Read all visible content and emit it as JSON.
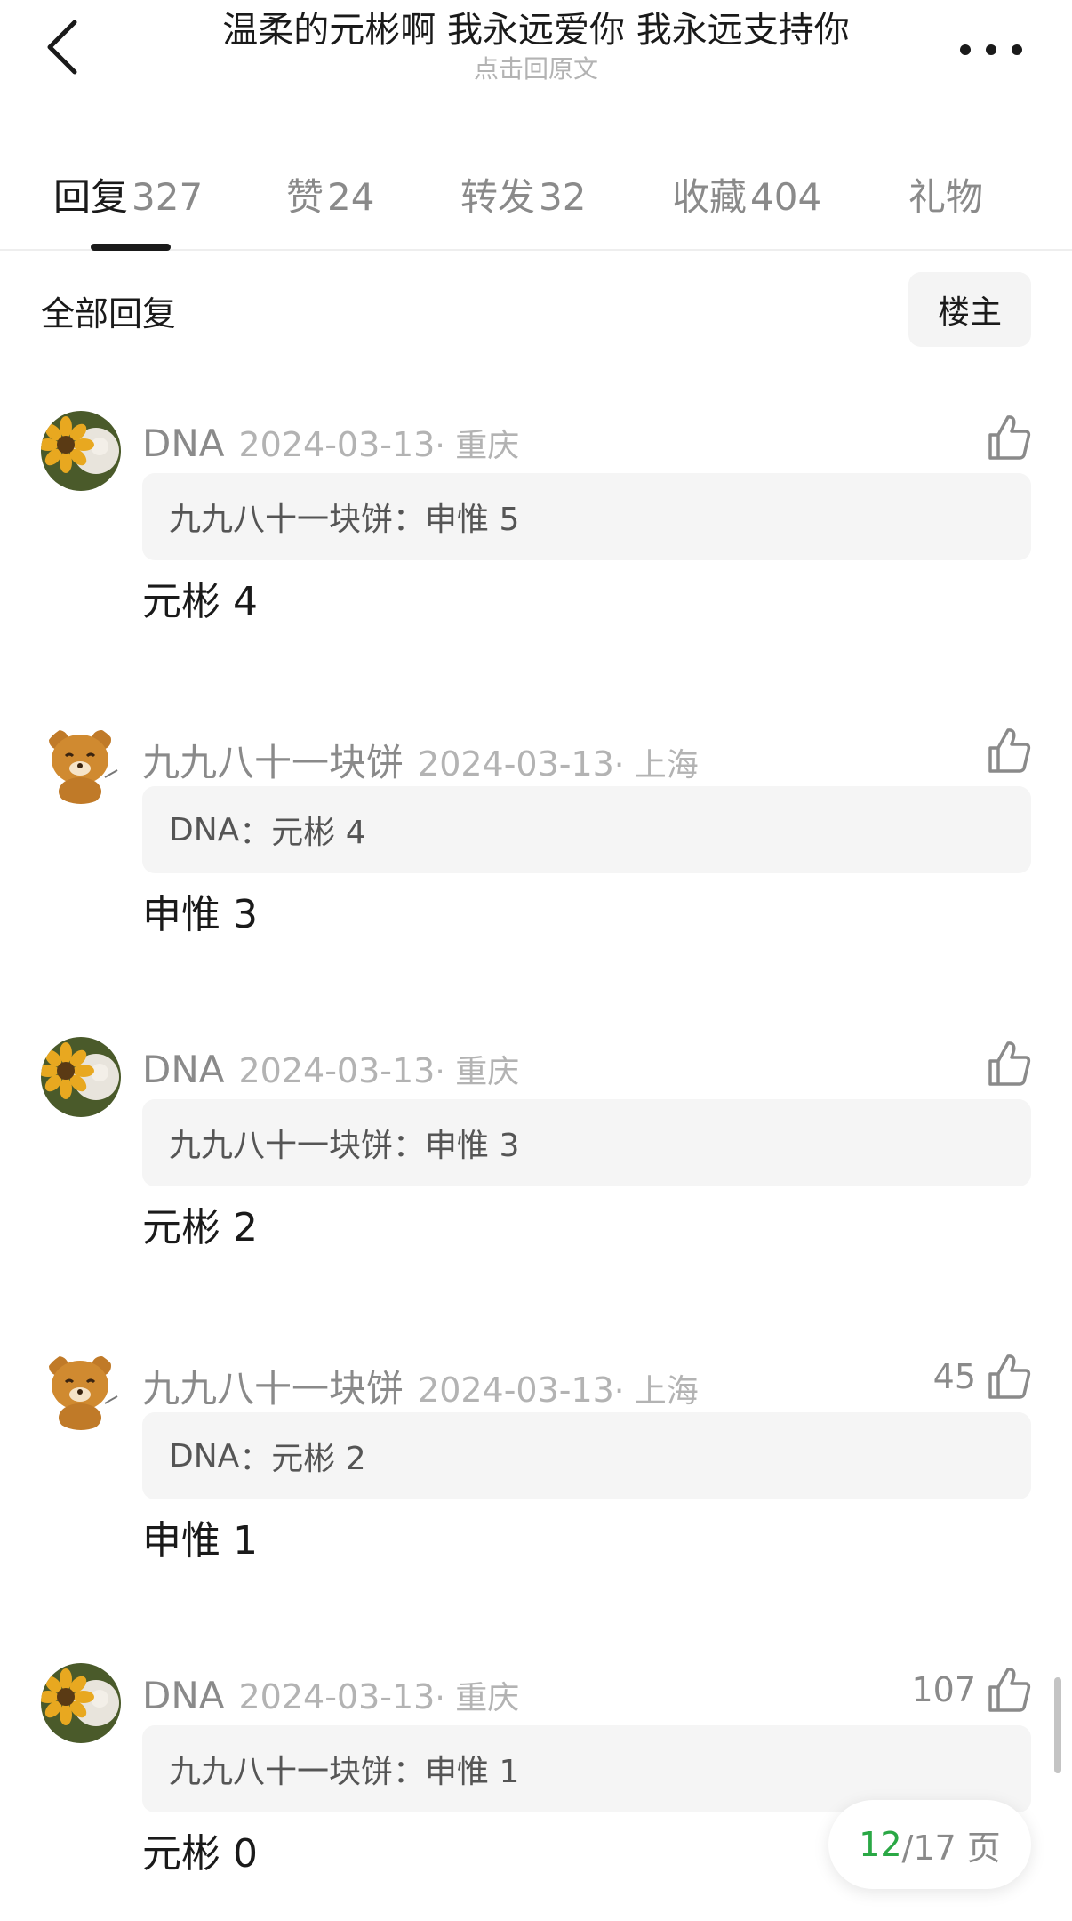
{
  "header": {
    "title": "温柔的元彬啊 我永远爱你 我永远支持你",
    "subtitle": "点击回原文",
    "back_icon": "chevron-left-icon",
    "more_icon": "more-dots-icon"
  },
  "tabs": [
    {
      "label": "回复",
      "count": "327",
      "active": true
    },
    {
      "label": "赞",
      "count": "24"
    },
    {
      "label": "转发",
      "count": "32"
    },
    {
      "label": "收藏",
      "count": "404"
    },
    {
      "label": "礼物",
      "count": ""
    }
  ],
  "filter": {
    "label": "全部回复",
    "op_button": "楼主"
  },
  "comments": [
    {
      "username": "DNA",
      "date": "2024-03-13",
      "location": "· 重庆",
      "likes": "",
      "quote_user": "九九八十一块饼",
      "quote_text": "申惟 5",
      "text": "元彬 4",
      "avatar": "sunflower-avatar"
    },
    {
      "username": "九九八十一块饼",
      "date": "2024-03-13",
      "location": "· 上海",
      "likes": "",
      "quote_user": "DNA",
      "quote_text": "元彬 4",
      "text": "申惟 3",
      "avatar": "bear-avatar"
    },
    {
      "username": "DNA",
      "date": "2024-03-13",
      "location": "· 重庆",
      "likes": "",
      "quote_user": "九九八十一块饼",
      "quote_text": "申惟 3",
      "text": "元彬 2",
      "avatar": "sunflower-avatar"
    },
    {
      "username": "九九八十一块饼",
      "date": "2024-03-13",
      "location": "· 上海",
      "likes": "45",
      "quote_user": "DNA",
      "quote_text": "元彬 2",
      "text": "申惟 1",
      "avatar": "bear-avatar"
    },
    {
      "username": "DNA",
      "date": "2024-03-13",
      "location": "· 重庆",
      "likes": "107",
      "quote_user": "九九八十一块饼",
      "quote_text": "申惟 1",
      "text": "元彬 0",
      "avatar": "sunflower-avatar"
    }
  ],
  "pagination": {
    "current": "12",
    "rest": "/17 页"
  },
  "colors": {
    "accent_green": "#2aa845",
    "text_primary": "#1a1a1a",
    "text_secondary": "#8a8a8a",
    "quote_bg": "#f5f5f5"
  }
}
